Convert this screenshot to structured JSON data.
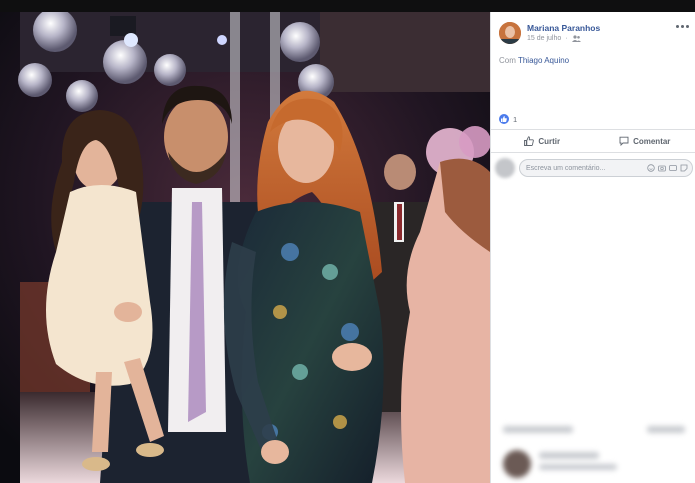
{
  "post": {
    "author": "Mariana Paranhos",
    "date": "15 de julho",
    "privacy_icon": "friends-icon",
    "with_prefix": "Com",
    "tagged_person": "Thiago Aquino",
    "like_count": "1"
  },
  "actions": {
    "like_label": "Curtir",
    "comment_label": "Comentar"
  },
  "comment_box": {
    "placeholder": "Escreva um comentário..."
  },
  "colors": {
    "link": "#385898",
    "like_blue": "#4b7bec",
    "muted": "#90949c",
    "viewer_bg": "#111111"
  }
}
